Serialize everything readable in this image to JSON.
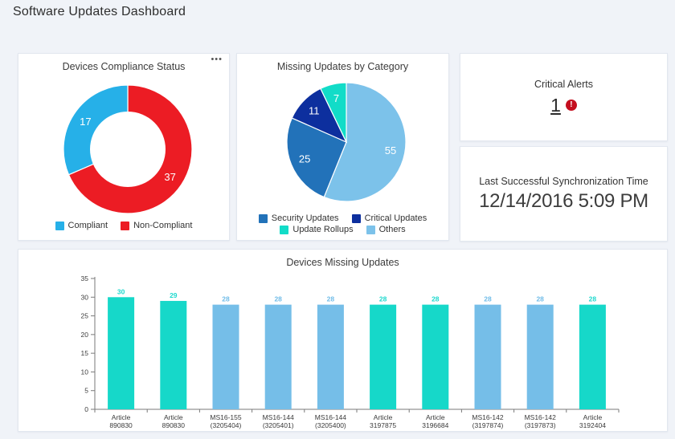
{
  "page": {
    "title": "Software Updates Dashboard"
  },
  "theme": {
    "background": "#F0F3F8",
    "card_background": "#FFFFFF",
    "card_border": "#E2E7EF",
    "axis_color": "#7a7a7a",
    "axis_text_color": "#3c3c3c"
  },
  "cards": {
    "compliance": {
      "title": "Devices Compliance Status",
      "menu_icon": "•••"
    },
    "category": {
      "title": "Missing Updates by Category"
    },
    "critical_alerts": {
      "label": "Critical Alerts",
      "count": "1",
      "icon_glyph": "!"
    },
    "sync_time": {
      "label": "Last Successful Synchronization Time",
      "value": "12/14/2016 5:09 PM"
    },
    "devices_missing": {
      "title": "Devices Missing Updates"
    }
  },
  "chart_data": [
    {
      "type": "pie",
      "variant": "donut",
      "title": "Devices Compliance Status",
      "slices": [
        {
          "label": "Non-Compliant",
          "value": 37,
          "color": "#EC1C24"
        },
        {
          "label": "Compliant",
          "value": 17,
          "color": "#26B0E8"
        }
      ],
      "legend_rows": [
        [
          "Compliant",
          "Non-Compliant"
        ]
      ],
      "legend_position": "bottom",
      "start_angle_deg": 0,
      "value_labels": true
    },
    {
      "type": "pie",
      "variant": "pie",
      "title": "Missing Updates by Category",
      "slices": [
        {
          "label": "Others",
          "value": 55,
          "color": "#7CC2EA"
        },
        {
          "label": "Security Updates",
          "value": 25,
          "color": "#2272B9"
        },
        {
          "label": "Critical Updates",
          "value": 11,
          "color": "#0D2F9E"
        },
        {
          "label": "Update Rollups",
          "value": 7,
          "color": "#12DCC8"
        }
      ],
      "legend_rows": [
        [
          "Security Updates",
          "Critical Updates"
        ],
        [
          "Update Rollups",
          "Others"
        ]
      ],
      "legend_position": "bottom",
      "start_angle_deg": 0,
      "value_labels": true
    },
    {
      "type": "bar",
      "title": "Devices Missing Updates",
      "categories": [
        [
          "Article",
          "890830"
        ],
        [
          "Article",
          "890830"
        ],
        [
          "MS16-155",
          "(3205404)"
        ],
        [
          "MS16-144",
          "(3205401)"
        ],
        [
          "MS16-144",
          "(3205400)"
        ],
        [
          "Article",
          "3197875"
        ],
        [
          "Article",
          "3196684"
        ],
        [
          "MS16-142",
          "(3197874)"
        ],
        [
          "MS16-142",
          "(3197873)"
        ],
        [
          "Article",
          "3192404"
        ]
      ],
      "values": [
        30,
        29,
        28,
        28,
        28,
        28,
        28,
        28,
        28,
        28
      ],
      "bar_colors": [
        "#16D8C9",
        "#16D8C9",
        "#75BEE8",
        "#75BEE8",
        "#75BEE8",
        "#16D8C9",
        "#16D8C9",
        "#75BEE8",
        "#75BEE8",
        "#16D8C9"
      ],
      "value_label_colors": [
        "#1ED9CE",
        "#1ED9CE",
        "#70BCE8",
        "#70BCE8",
        "#70BCE8",
        "#1ED9CE",
        "#1ED9CE",
        "#70BCE8",
        "#70BCE8",
        "#1ED9CE"
      ],
      "ylim": [
        0,
        35
      ],
      "ytick_step": 5,
      "grid": false,
      "value_labels": true
    }
  ]
}
